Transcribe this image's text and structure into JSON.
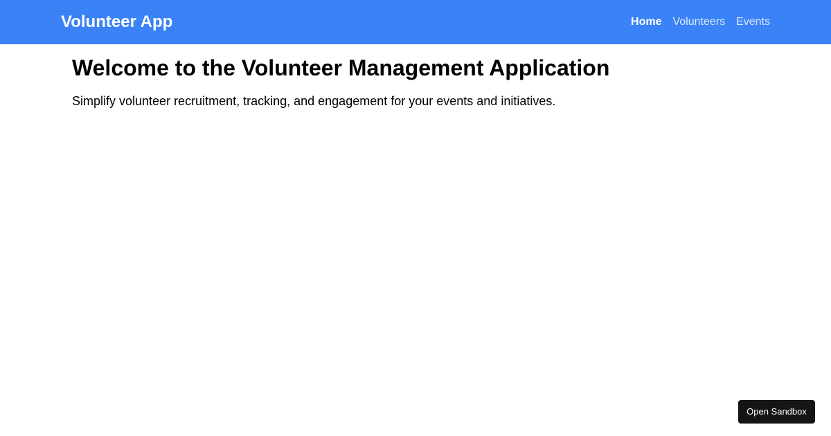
{
  "header": {
    "brand": "Volunteer App",
    "nav_items": [
      {
        "label": "Home",
        "active": true
      },
      {
        "label": "Volunteers",
        "active": false
      },
      {
        "label": "Events",
        "active": false
      }
    ]
  },
  "main": {
    "title": "Welcome to the Volunteer Management Application",
    "subtitle": "Simplify volunteer recruitment, tracking, and engagement for your events and initiatives."
  },
  "sandbox": {
    "button_label": "Open Sandbox"
  },
  "colors": {
    "navbar": "#3b82f6",
    "nav_inactive": "#dbeafe",
    "sandbox_button": "#151515"
  }
}
